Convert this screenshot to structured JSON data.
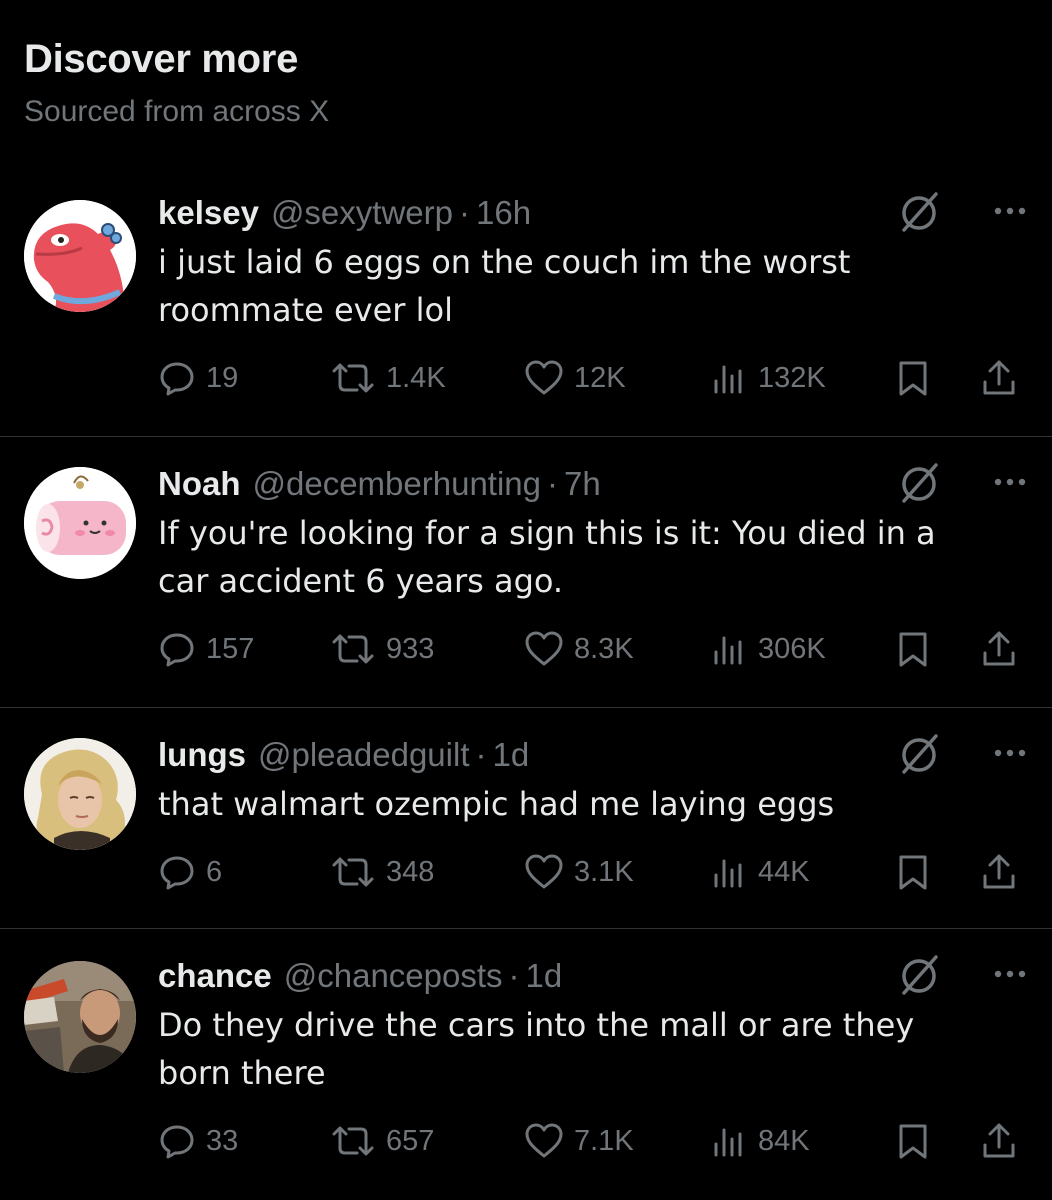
{
  "header": {
    "title": "Discover more",
    "subtitle": "Sourced from across X"
  },
  "posts": [
    {
      "display_name": "kelsey",
      "handle": "@sexytwerp",
      "time": "16h",
      "text": "i just laid 6 eggs on the couch im the worst\nroommate ever lol",
      "replies": "19",
      "reposts": "1.4K",
      "likes": "12K",
      "views": "132K",
      "avatar": "red-cartoon-creature-avatar"
    },
    {
      "display_name": "Noah",
      "handle": "@decemberhunting",
      "time": "7h",
      "text": "If you're looking for a sign this is it: You died in a\ncar accident 6 years ago.",
      "replies": "157",
      "reposts": "933",
      "likes": "8.3K",
      "views": "306K",
      "avatar": "pink-roll-cake-avatar"
    },
    {
      "display_name": "lungs",
      "handle": "@pleadedguilt",
      "time": "1d",
      "text": "that walmart ozempic had me laying eggs",
      "replies": "6",
      "reposts": "348",
      "likes": "3.1K",
      "views": "44K",
      "avatar": "blonde-person-photo-avatar"
    },
    {
      "display_name": "chance",
      "handle": "@chanceposts",
      "time": "1d",
      "text": "Do they drive the cars into the mall or are they\nborn there",
      "replies": "33",
      "reposts": "657",
      "likes": "7.1K",
      "views": "84K",
      "avatar": "bearded-man-photo-avatar"
    }
  ],
  "icons": {
    "grok": "grok-icon",
    "more": "more-icon",
    "reply": "reply-icon",
    "repost": "repost-icon",
    "like": "heart-icon",
    "views": "views-icon",
    "bookmark": "bookmark-icon",
    "share": "share-icon"
  },
  "colors": {
    "background": "#000000",
    "primary_text": "#e7e9ea",
    "secondary_text": "#71767b",
    "divider": "#2f3336"
  }
}
